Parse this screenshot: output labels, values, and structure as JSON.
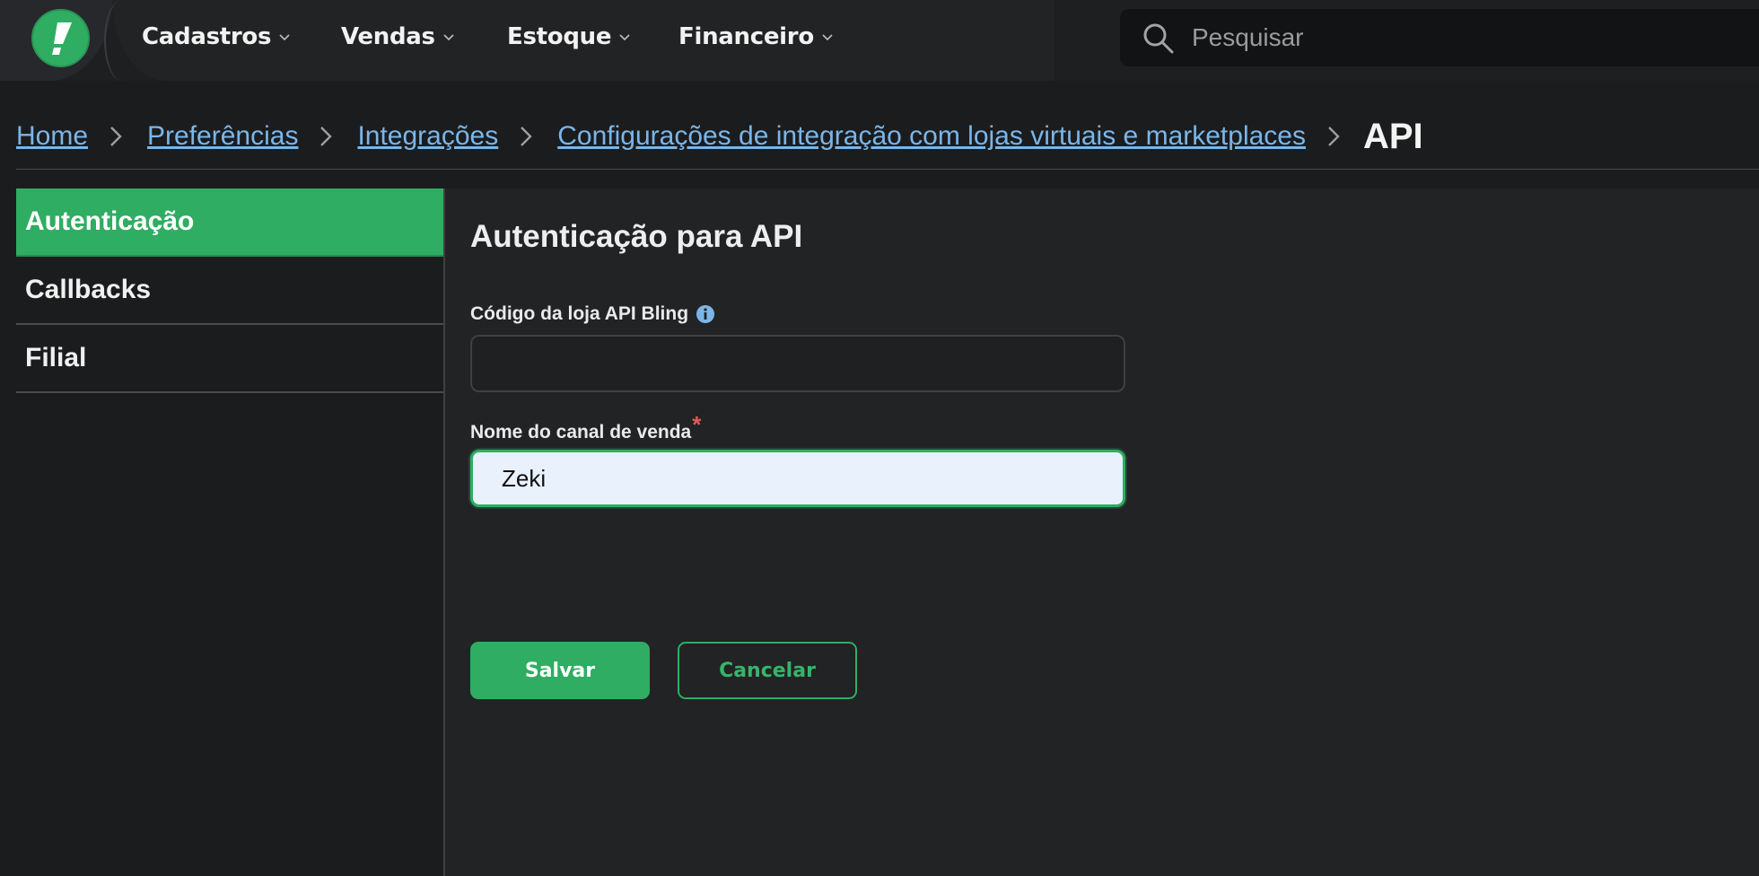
{
  "nav": {
    "menu": [
      {
        "label": "Cadastros"
      },
      {
        "label": "Vendas"
      },
      {
        "label": "Estoque"
      },
      {
        "label": "Financeiro"
      }
    ],
    "search_placeholder": "Pesquisar"
  },
  "breadcrumb": {
    "links": [
      "Home",
      "Preferências",
      "Integrações",
      "Configurações de integração com lojas virtuais e marketplaces"
    ],
    "current": "API"
  },
  "sidebar": {
    "items": [
      {
        "label": "Autenticação",
        "active": true
      },
      {
        "label": "Callbacks",
        "active": false
      },
      {
        "label": "Filial",
        "active": false
      }
    ]
  },
  "main": {
    "title": "Autenticação para API",
    "fields": [
      {
        "label": "Código da loja API Bling",
        "value": "",
        "has_info": true
      },
      {
        "label": "Nome do canal de venda",
        "required_mark": "*",
        "value": "Zeki"
      }
    ],
    "save_label": "Salvar",
    "cancel_label": "Cancelar"
  },
  "colors": {
    "accent": "#2fad62",
    "link": "#7ab6e8",
    "required": "#e05a5a"
  },
  "icons": {
    "logo": "bling-logo",
    "search": "search-icon",
    "info": "info-icon",
    "chevron": "chevron-down-icon",
    "separator": "chevron-right-icon"
  }
}
